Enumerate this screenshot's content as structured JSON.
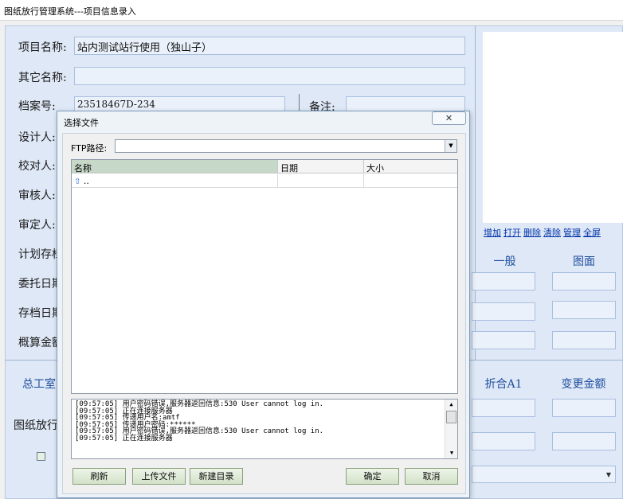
{
  "window": {
    "title": "图纸放行管理系统---项目信息录入"
  },
  "form": {
    "project_name_label": "项目名称:",
    "project_name_value": "站内测试站行使用（独山子）",
    "other_name_label": "其它名称:",
    "other_name_value": "",
    "archive_no_label": "档案号:",
    "archive_no_value": "23518467D-234",
    "remark_label": "备注:",
    "remark_value": "",
    "designer_label": "设计人:",
    "checker_label": "校对人:",
    "reviewer_label": "审核人:",
    "approver_label": "审定人:",
    "plan_label": "计划存档",
    "commission_label": "委托日期",
    "archive_date_label": "存档日期",
    "budget_label": "概算金额",
    "chief_label": "总工室",
    "release_label": "图纸放行"
  },
  "right_panel": {
    "links": [
      "增加",
      "打开",
      "删除",
      "清除",
      "管理",
      "全屏"
    ],
    "col_general": "一般",
    "col_drawing": "图面",
    "col_fold": "折合A1",
    "col_change": "变更金额"
  },
  "dialog": {
    "title": "选择文件",
    "close_label": "✕",
    "ftp_label": "FTP路径:",
    "ftp_value": "",
    "columns": [
      "名称",
      "日期",
      "大小"
    ],
    "rows": [
      {
        "name": "..",
        "date": "",
        "size": ""
      }
    ],
    "log_lines": [
      "[09:57:05] 用户密码错误,服务器返回信息:530 User cannot log in.",
      "[09:57:05] 正在连接服务器",
      "[09:57:05] 传递用户名:amtf",
      "[09:57:05] 传递用户密码:******",
      "[09:57:05] 用户密码错误,服务器返回信息:530 User cannot log in.",
      "[09:57:05] 正在连接服务器"
    ],
    "buttons": {
      "refresh": "刷新",
      "upload": "上传文件",
      "new_folder": "新建目录",
      "ok": "确定",
      "cancel": "取消"
    }
  }
}
